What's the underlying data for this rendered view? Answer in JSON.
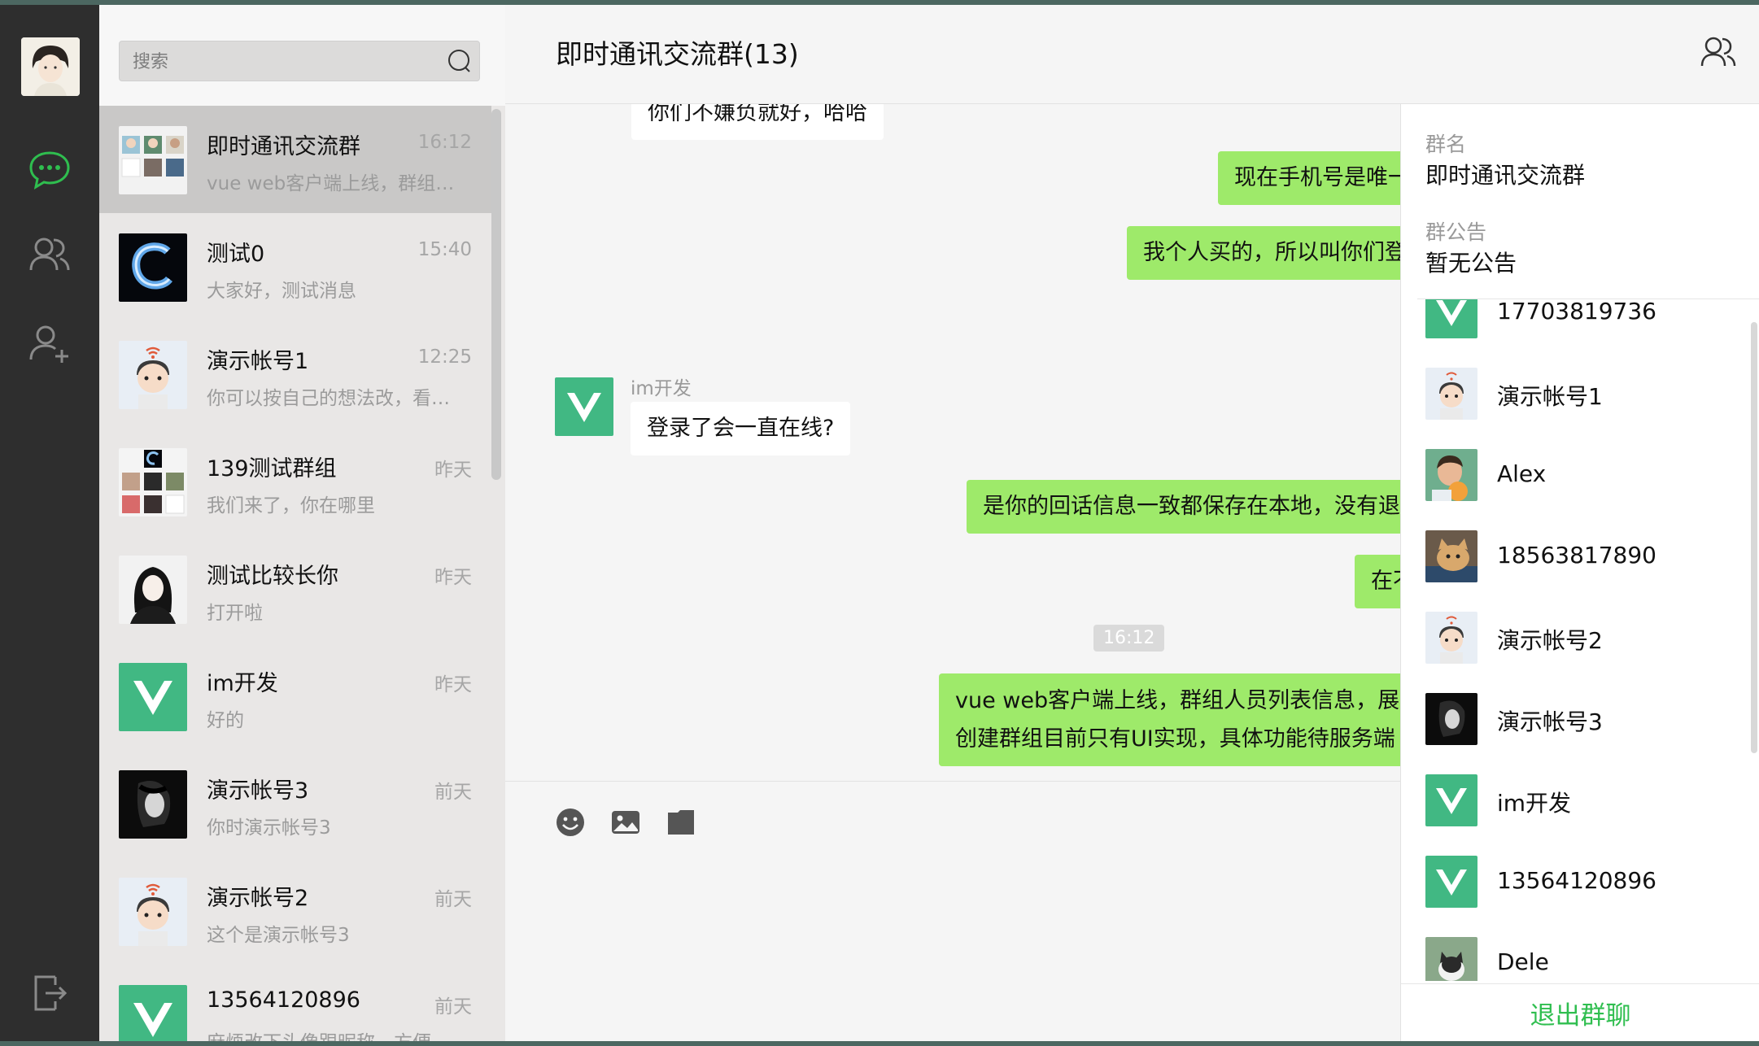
{
  "colors": {
    "accent": "#2fbe4f",
    "bubble_out": "#9eea6a",
    "rail": "#2e2e2e",
    "vue_green": "#41b883"
  },
  "nav": {
    "items": [
      {
        "icon": "chat-bubble-icon",
        "active": true
      },
      {
        "icon": "contacts-icon",
        "active": false
      },
      {
        "icon": "add-friend-icon",
        "active": false
      }
    ],
    "logout_icon": "logout-icon"
  },
  "search": {
    "placeholder": "搜索",
    "value": ""
  },
  "conversations": [
    {
      "name": "即时通讯交流群",
      "time": "16:12",
      "preview": "vue web客户端上线，群组人员列表信息，展示",
      "avatar": "group-collage",
      "active": true
    },
    {
      "name": "测试0",
      "time": "15:40",
      "preview": "大家好，测试消息",
      "avatar": "letter-c"
    },
    {
      "name": "演示帐号1",
      "time": "12:25",
      "preview": "你可以按自己的想法改，看得到效果",
      "avatar": "cartoon-boy"
    },
    {
      "name": "139测试群组",
      "time": "昨天",
      "preview": "我们来了，你在哪里",
      "avatar": "group-collage-2"
    },
    {
      "name": "测试比较长你",
      "time": "昨天",
      "preview": "打开啦",
      "avatar": "girl-sketch"
    },
    {
      "name": "im开发",
      "time": "昨天",
      "preview": "好的",
      "avatar": "vue-logo"
    },
    {
      "name": "演示帐号3",
      "time": "前天",
      "preview": "你时演示帐号3",
      "avatar": "dark-portrait"
    },
    {
      "name": "演示帐号2",
      "time": "前天",
      "preview": "这个是演示帐号3",
      "avatar": "cartoon-boy"
    },
    {
      "name": "13564120896",
      "time": "前天",
      "preview": "麻烦改下头像跟昵称，方便",
      "avatar": "vue-logo"
    }
  ],
  "chat": {
    "title": "即时通讯交流群(13)",
    "members_icon": "members-icon",
    "messages": [
      {
        "type": "in",
        "text": "你们不嫌负就好，哈哈"
      },
      {
        "type": "out",
        "text": "现在手机号是唯一"
      },
      {
        "type": "out",
        "text": "我个人买的，所以叫你们登"
      },
      {
        "type": "in",
        "sender": "im开发",
        "text": "登录了会一直在线?"
      },
      {
        "type": "out",
        "text": "是你的回话信息一致都保存在本地，没有退"
      },
      {
        "type": "out",
        "text": "在不"
      },
      {
        "type": "time",
        "text": "16:12"
      },
      {
        "type": "out",
        "lines": [
          "vue web客户端上线，群组人员列表信息，展示",
          "创建群组目前只有UI实现，具体功能待服务端"
        ]
      }
    ],
    "toolbar": [
      {
        "icon": "emoji-icon"
      },
      {
        "icon": "image-icon"
      },
      {
        "icon": "folder-icon"
      }
    ]
  },
  "group_info": {
    "name_label": "群名",
    "name_value": "即时通讯交流群",
    "notice_label": "群公告",
    "notice_value": "暂无公告",
    "members": [
      {
        "name": "17703819736",
        "avatar": "vue-logo"
      },
      {
        "name": "演示帐号1",
        "avatar": "cartoon-boy"
      },
      {
        "name": "Alex",
        "avatar": "kid-photo"
      },
      {
        "name": "18563817890",
        "avatar": "cat-photo"
      },
      {
        "name": "演示帐号2",
        "avatar": "cartoon-boy"
      },
      {
        "name": "演示帐号3",
        "avatar": "dark-portrait"
      },
      {
        "name": "im开发",
        "avatar": "vue-logo"
      },
      {
        "name": "13564120896",
        "avatar": "vue-logo"
      },
      {
        "name": "Dele",
        "avatar": "cat-photo-2"
      }
    ],
    "exit_label": "退出群聊"
  }
}
